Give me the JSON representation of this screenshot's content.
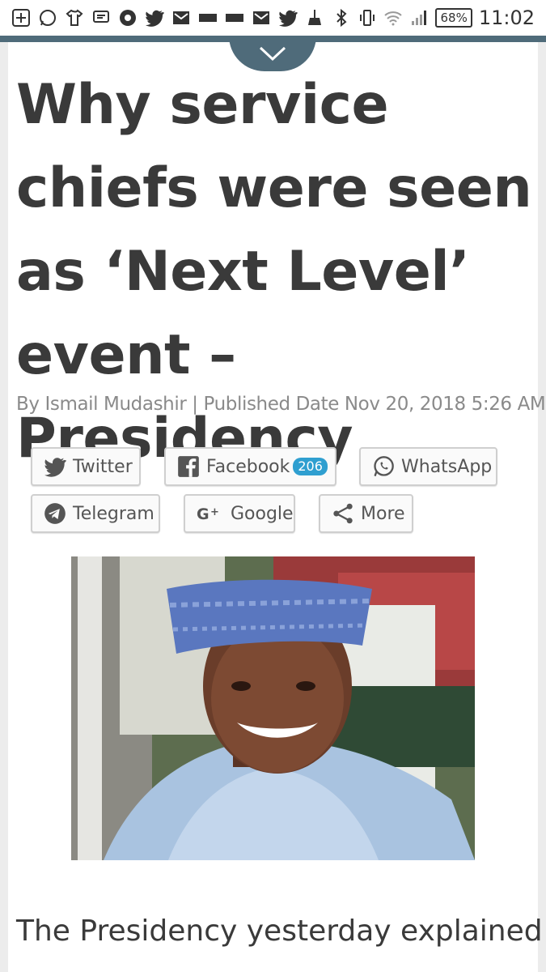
{
  "status_bar": {
    "icons": [
      "plus-box-icon",
      "whatsapp-icon",
      "shirt-icon",
      "message-icon",
      "chrome-icon",
      "twitter-icon",
      "gmail-icon",
      "bar-icon",
      "bar-icon",
      "gmail-icon",
      "twitter-icon",
      "broom-icon",
      "bluetooth-icon",
      "vibrate-icon",
      "wifi-icon",
      "signal-icon"
    ],
    "battery": "68%",
    "time": "11:02"
  },
  "article": {
    "headline": "Why service chiefs were seen as ‘Next Level’ event – Presidency",
    "byline": "By Ismail Mudashir | Published Date Nov 20, 2018 5:26 AM",
    "body_start": "The Presidency yesterday explained"
  },
  "share": {
    "twitter": "Twitter",
    "facebook": "Facebook",
    "facebook_count": "206",
    "whatsapp": "WhatsApp",
    "telegram": "Telegram",
    "google": "Google",
    "more": "More"
  },
  "colors": {
    "accent_band": "#4f6b7a",
    "badge": "#2f9fd0",
    "headline": "#3a3a3a",
    "byline": "#8a8a8a"
  }
}
